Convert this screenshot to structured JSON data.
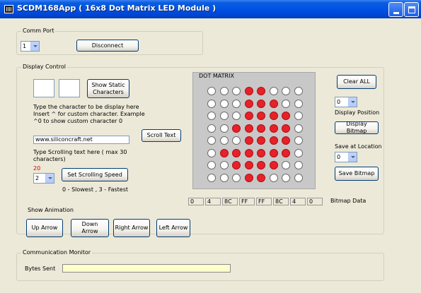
{
  "window": {
    "title": "SCDM168App ( 16x8 Dot Matrix LED Module )"
  },
  "comm_port": {
    "group_label": "Comm Port",
    "port_value": "1",
    "disconnect_label": "Disconnect"
  },
  "display_control": {
    "group_label": "Display Control",
    "show_static_label": "Show Static\nCharacters",
    "instructions": [
      "Type the character to be display here",
      "Insert ^ for custom character. Example",
      "^0 to show custom character 0"
    ],
    "scroll_text_value": "www.siliconcraft.net",
    "scroll_text_button": "Scroll Text",
    "scroll_hint": [
      "Type Scrolling text here ( max 30",
      "characters)"
    ],
    "speed_value_red": "20",
    "speed_select_value": "2",
    "set_speed_label": "Set Scrolling Speed",
    "speed_hint": "0 - Slowest , 3 - Fastest",
    "show_animation_label": "Show Animation",
    "anim_buttons": [
      "Up Arrow",
      "Down\nArrow",
      "Right Arrow",
      "Left Arrow"
    ]
  },
  "matrix": {
    "title": "DOT MATRIX",
    "rows": [
      [
        0,
        0,
        0,
        1,
        1,
        0,
        0,
        0
      ],
      [
        0,
        0,
        0,
        1,
        1,
        1,
        0,
        0
      ],
      [
        0,
        0,
        0,
        1,
        1,
        1,
        1,
        0
      ],
      [
        0,
        0,
        1,
        1,
        1,
        1,
        1,
        0
      ],
      [
        0,
        0,
        0,
        1,
        1,
        1,
        1,
        0
      ],
      [
        0,
        1,
        1,
        1,
        1,
        1,
        1,
        0
      ],
      [
        0,
        0,
        1,
        1,
        1,
        1,
        0,
        0
      ],
      [
        0,
        0,
        0,
        1,
        1,
        0,
        0,
        0
      ]
    ],
    "on_color": "#e8202a",
    "off_color": "#ffffff"
  },
  "bitmap": {
    "bytes": [
      "0",
      "4",
      "8C",
      "FF",
      "FF",
      "8C",
      "4",
      "0"
    ],
    "label": "Bitmap Data"
  },
  "right_panel": {
    "clear_all": "Clear ALL",
    "display_position_value": "0",
    "display_position_label": "Display Position",
    "display_bitmap": "Display Bitmap",
    "save_at_label": "Save at Location",
    "save_location_value": "0",
    "save_bitmap": "Save Bitmap"
  },
  "comm_monitor": {
    "group_label": "Communication Monitor",
    "bytes_sent_label": "Bytes Sent",
    "bytes_sent_value": ""
  }
}
